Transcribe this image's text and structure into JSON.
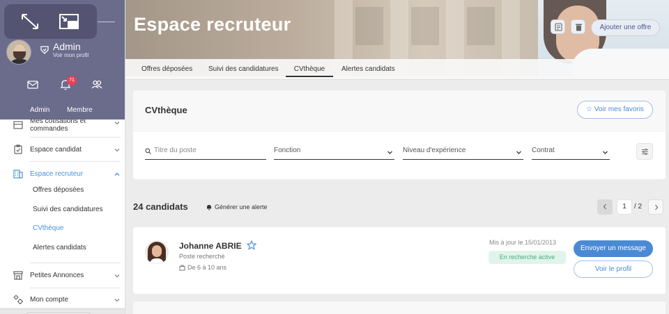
{
  "sidebar": {
    "user": {
      "name": "Admin",
      "profile_link": "Voir mon profil"
    },
    "notifications_count": "71",
    "roles": [
      "Admin",
      "Membre"
    ],
    "menu": {
      "cotisations": "Mes cotisations et commandes",
      "espace_candidat": "Espace candidat",
      "espace_recruteur": "Espace recruteur",
      "sub_items": [
        "Offres déposées",
        "Suivi des candidatures",
        "CVthèque",
        "Alertes candidats"
      ],
      "petites_annonces": "Petites Annonces",
      "mon_compte": "Mon compte"
    }
  },
  "header": {
    "title": "Espace recruteur",
    "add_offer": "Ajouter une offre"
  },
  "tabs": [
    "Offres déposées",
    "Suivi des candidatures",
    "CVthèque",
    "Alertes candidats"
  ],
  "active_tab": "CVthèque",
  "cvtheque": {
    "title": "CVthèque",
    "favorites_button": "Voir mes favoris",
    "filters": {
      "search_placeholder": "Titre du poste",
      "fonction": "Fonction",
      "niveau": "Niveau d'expérience",
      "contrat": "Contrat"
    }
  },
  "results": {
    "count_label": "24 candidats",
    "alert_link": "Générer une alerte",
    "pagination": {
      "current": "1",
      "total": "/ 2"
    }
  },
  "candidates": [
    {
      "name": "Johanne ABRIE",
      "subtitle": "Poste recherché",
      "experience": "De 6 à 10 ans",
      "updated": "Mis à jour le 15/01/2013",
      "status": "En recherche active",
      "message_button": "Envoyer un message",
      "profile_button": "Voir le profil"
    }
  ],
  "colors": {
    "sidebar_panel": "#6b6b8c",
    "accent_blue": "#4a8ad4",
    "status_green": "#4aaa7e",
    "notification_red": "#e4415b"
  }
}
